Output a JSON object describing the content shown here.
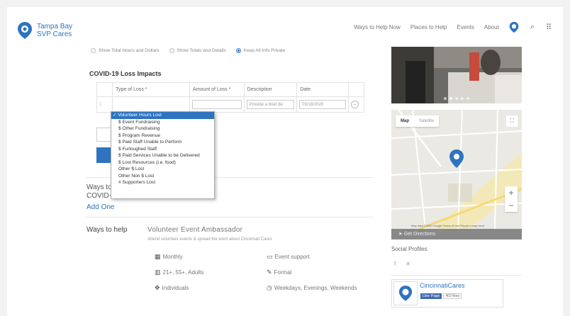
{
  "header": {
    "logo_line1": "Tampa Bay",
    "logo_line2": "SVP Cares",
    "nav": [
      "Ways to Help Now",
      "Places to Help",
      "Events",
      "About"
    ],
    "search_glyph": "⌕",
    "grid_glyph": "⠿"
  },
  "privacy": {
    "options": [
      "Show Total Hours and Dollars",
      "Show Totals and Details",
      "Keep All Info Private"
    ],
    "selected_index": 2
  },
  "loss_section": {
    "title": "COVID-19 Loss Impacts",
    "columns": [
      "Type of Loss *",
      "Amount of Loss *",
      "Description",
      "Date"
    ],
    "row": {
      "index": "1",
      "description_placeholder": "Provide a brief de:",
      "date": "03/18/2020",
      "remove": "−"
    }
  },
  "loss_dropdown": {
    "selected": "Volunteer Hours Lost",
    "options": [
      "✓ Volunteer Hours Lost",
      "$ Event Fundraising",
      "$ Other Fundraising",
      "$ Program Revenue",
      "$ Paid Staff Unable to Perform",
      "$ Furloughed Staff",
      "$ Paid Services Unable to be Delivered",
      "$ Lost Resources (i.e. food)",
      "Other $ Lost",
      "Other Non $ Lost",
      "# Supporters Lost"
    ]
  },
  "ways_now": {
    "line1": "Ways to",
    "line2": "COVID-19 Now",
    "add_one": "Add One"
  },
  "ways_to_help": {
    "label": "Ways to help",
    "event_title": "Volunteer Event Ambassador",
    "event_desc": "Attend volunteer events & spread the word about Cincinnati Cares",
    "attrs": [
      {
        "icon": "calendar-icon",
        "glyph": "▦",
        "text": "Monthly"
      },
      {
        "icon": "monitor-icon",
        "glyph": "▭",
        "text": "Event support"
      },
      {
        "icon": "people-icon",
        "glyph": "▥",
        "text": "21+, 55+, Adults"
      },
      {
        "icon": "pencil-icon",
        "glyph": "✎",
        "text": "Formal"
      },
      {
        "icon": "group-icon",
        "glyph": "✥",
        "text": "Individuals"
      },
      {
        "icon": "clock-icon",
        "glyph": "◷",
        "text": "Weekdays, Evenings, Weekends"
      }
    ]
  },
  "map": {
    "tabs": [
      "Map",
      "Satellite"
    ],
    "fullscreen": "⛶",
    "zoom_in": "+",
    "zoom_out": "−",
    "credit": "Map data ©2020 Google   Terms of Use   Report a map error",
    "directions": "Get Directions"
  },
  "social": {
    "title": "Social Profiles",
    "facebook": "f",
    "twitter": "🐦"
  },
  "facebook_box": {
    "name": "CincinnatiCares",
    "like_label": "Like Page",
    "likes": "402 likes"
  },
  "colors": {
    "accent": "#2e74c0",
    "facebook": "#4267b2"
  }
}
